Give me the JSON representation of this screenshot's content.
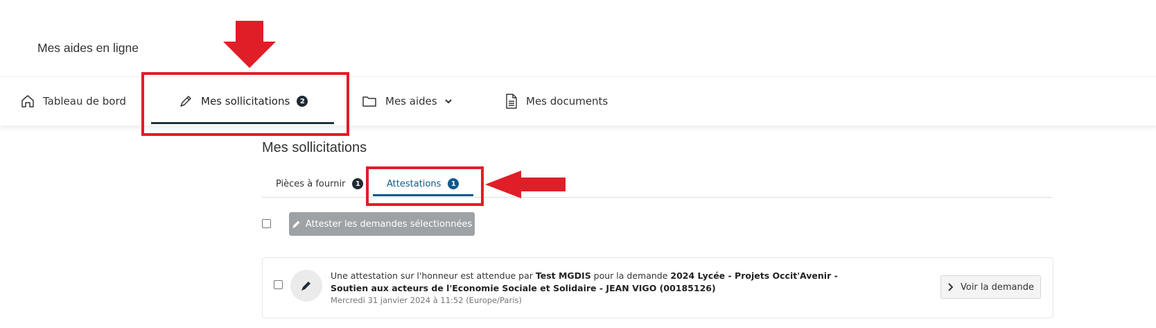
{
  "header": {
    "site_title": "Mes aides en ligne"
  },
  "nav": {
    "items": [
      {
        "label": "Tableau de bord",
        "icon": "home-icon"
      },
      {
        "label": "Mes sollicitations",
        "icon": "pen-icon",
        "badge": "2",
        "active": true
      },
      {
        "label": "Mes aides",
        "icon": "folder-icon",
        "dropdown": true
      },
      {
        "label": "Mes documents",
        "icon": "document-icon"
      }
    ]
  },
  "page": {
    "title": "Mes sollicitations",
    "tabs": [
      {
        "label": "Pièces à fournir",
        "badge": "1"
      },
      {
        "label": "Attestations",
        "badge": "1",
        "active": true
      }
    ],
    "attest_button": "Attester les demandes sélectionnées"
  },
  "card": {
    "text_prefix": "Une attestation sur l'honneur est attendue par ",
    "requester": "Test MGDIS",
    "text_middle": " pour la demande ",
    "demande": "2024 Lycée - Projets Occit'Avenir - Soutien aux acteurs de l'Economie Sociale et Solidaire - JEAN VIGO (00185126)",
    "date": "Mercredi 31 janvier 2024 à 11:52 (Europe/Paris)",
    "button": "Voir la demande"
  },
  "colors": {
    "highlight": "#e01e28",
    "accent": "#0a5a8a",
    "dark": "#1c3440"
  }
}
